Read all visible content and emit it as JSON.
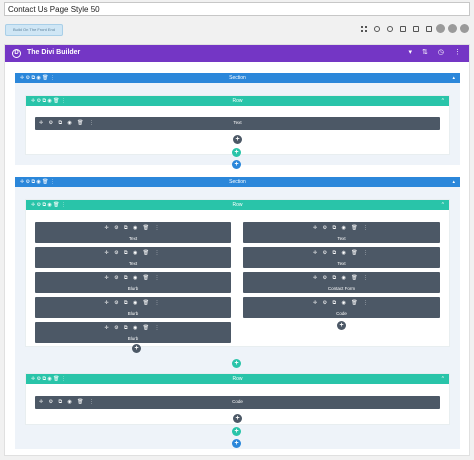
{
  "page": {
    "title": "Contact Us Page Style 50"
  },
  "toolbar": {
    "visual_builder_label": "Build On The Front End"
  },
  "builder": {
    "name": "The Divi Builder",
    "logo": "D",
    "controls": [
      "▾",
      "⇅",
      "◷",
      "⋮"
    ]
  },
  "tools": "✛ ⚙ ⧉ ◉ 🗑 ⋮",
  "labels": {
    "section": "Section",
    "row": "Row"
  },
  "sections": [
    {
      "rows": [
        {
          "modules": [
            "Text"
          ]
        }
      ]
    },
    {
      "rows": [
        {
          "columns": [
            [
              "Text",
              "Text",
              "Blurb",
              "Blurb",
              "Blurb"
            ],
            [
              "Text",
              "Text",
              "Contact Form",
              "Code"
            ]
          ]
        },
        {
          "modules": [
            "Code"
          ]
        }
      ]
    }
  ],
  "icons": {
    "add": "+",
    "collapse": "^",
    "caret": "▴"
  }
}
